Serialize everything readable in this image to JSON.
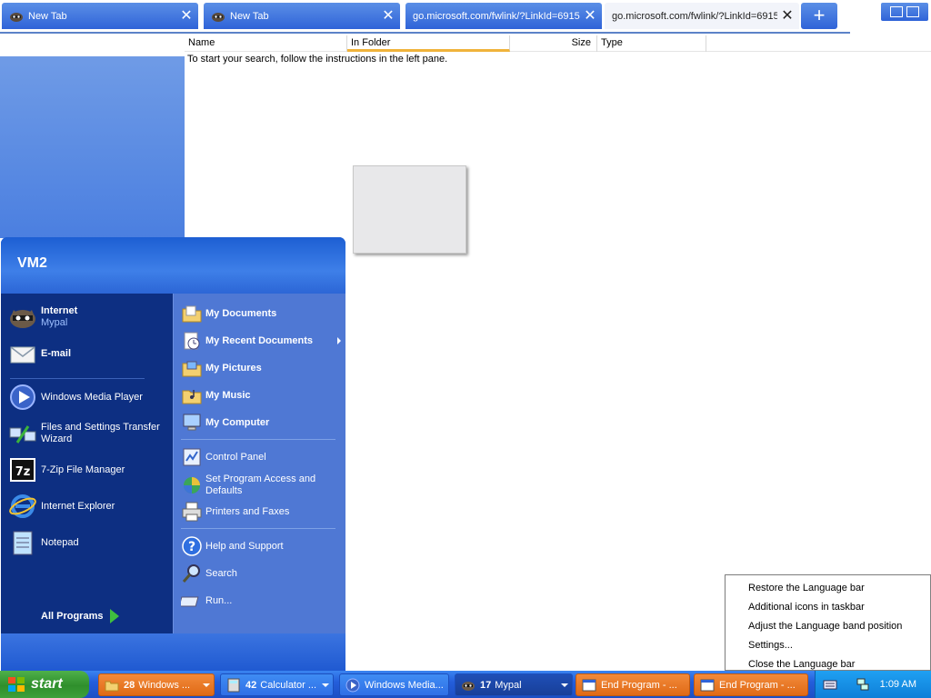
{
  "browser": {
    "tabs": [
      {
        "title": "New Tab",
        "active": false
      },
      {
        "title": "New Tab",
        "active": false
      },
      {
        "title": "go.microsoft.com/fwlink/?LinkId=6915",
        "active": false
      },
      {
        "title": "go.microsoft.com/fwlink/?LinkId=6915",
        "active": true
      }
    ],
    "new_tab_symbol": "+",
    "close_symbol": "✕"
  },
  "results": {
    "columns": [
      "Name",
      "In Folder",
      "Size",
      "Type"
    ],
    "message": "To start your search, follow the instructions in the left pane."
  },
  "start_menu": {
    "user": "VM2",
    "pinned": [
      {
        "label": "Internet",
        "sub": "Mypal",
        "icon": "mypal-raccoon-icon"
      },
      {
        "label": "E-mail",
        "icon": "email-envelope-icon"
      }
    ],
    "recent": [
      {
        "label": "Windows Media Player",
        "icon": "media-player-icon"
      },
      {
        "label": "Files and Settings Transfer Wizard",
        "icon": "transfer-wizard-icon"
      },
      {
        "label": "7-Zip File Manager",
        "icon": "7zip-icon"
      },
      {
        "label": "Internet Explorer",
        "icon": "ie-icon"
      },
      {
        "label": "Notepad",
        "icon": "notepad-icon"
      }
    ],
    "all_programs": "All Programs",
    "right": [
      {
        "label": "My Documents",
        "bold": true
      },
      {
        "label": "My Recent Documents",
        "bold": true
      },
      {
        "label": "My Pictures",
        "bold": true
      },
      {
        "label": "My Music",
        "bold": true
      },
      {
        "label": "My Computer",
        "bold": true
      },
      {
        "label": "Control Panel",
        "bold": false
      },
      {
        "label": "Set Program Access and Defaults",
        "bold": false
      },
      {
        "label": "Printers and Faxes",
        "bold": false
      },
      {
        "label": "Help and Support",
        "bold": false
      },
      {
        "label": "Search",
        "bold": false
      },
      {
        "label": "Run...",
        "bold": false
      }
    ]
  },
  "context_menu": {
    "items": [
      "Restore the Language bar",
      "Additional icons in taskbar",
      "Adjust the Language band position",
      "Settings...",
      "Close the Language bar"
    ]
  },
  "taskbar": {
    "start_label": "start",
    "tasks": [
      {
        "count": "28",
        "label": "Windows ...",
        "style": "orange",
        "grouped": true
      },
      {
        "count": "42",
        "label": "Calculator ...",
        "style": "blue",
        "grouped": true
      },
      {
        "count": "",
        "label": "Windows Media...",
        "style": "blue",
        "grouped": false
      },
      {
        "count": "17",
        "label": "Mypal",
        "style": "dark",
        "grouped": true
      },
      {
        "count": "",
        "label": "End Program - ...",
        "style": "orange",
        "grouped": false
      },
      {
        "count": "",
        "label": "End Program - ...",
        "style": "orange",
        "grouped": false
      }
    ],
    "clock": "1:09 AM"
  },
  "colors": {
    "xp_blue": "#245edb",
    "start_green": "#2f8f2c",
    "highlight_orange": "#e06a16"
  }
}
